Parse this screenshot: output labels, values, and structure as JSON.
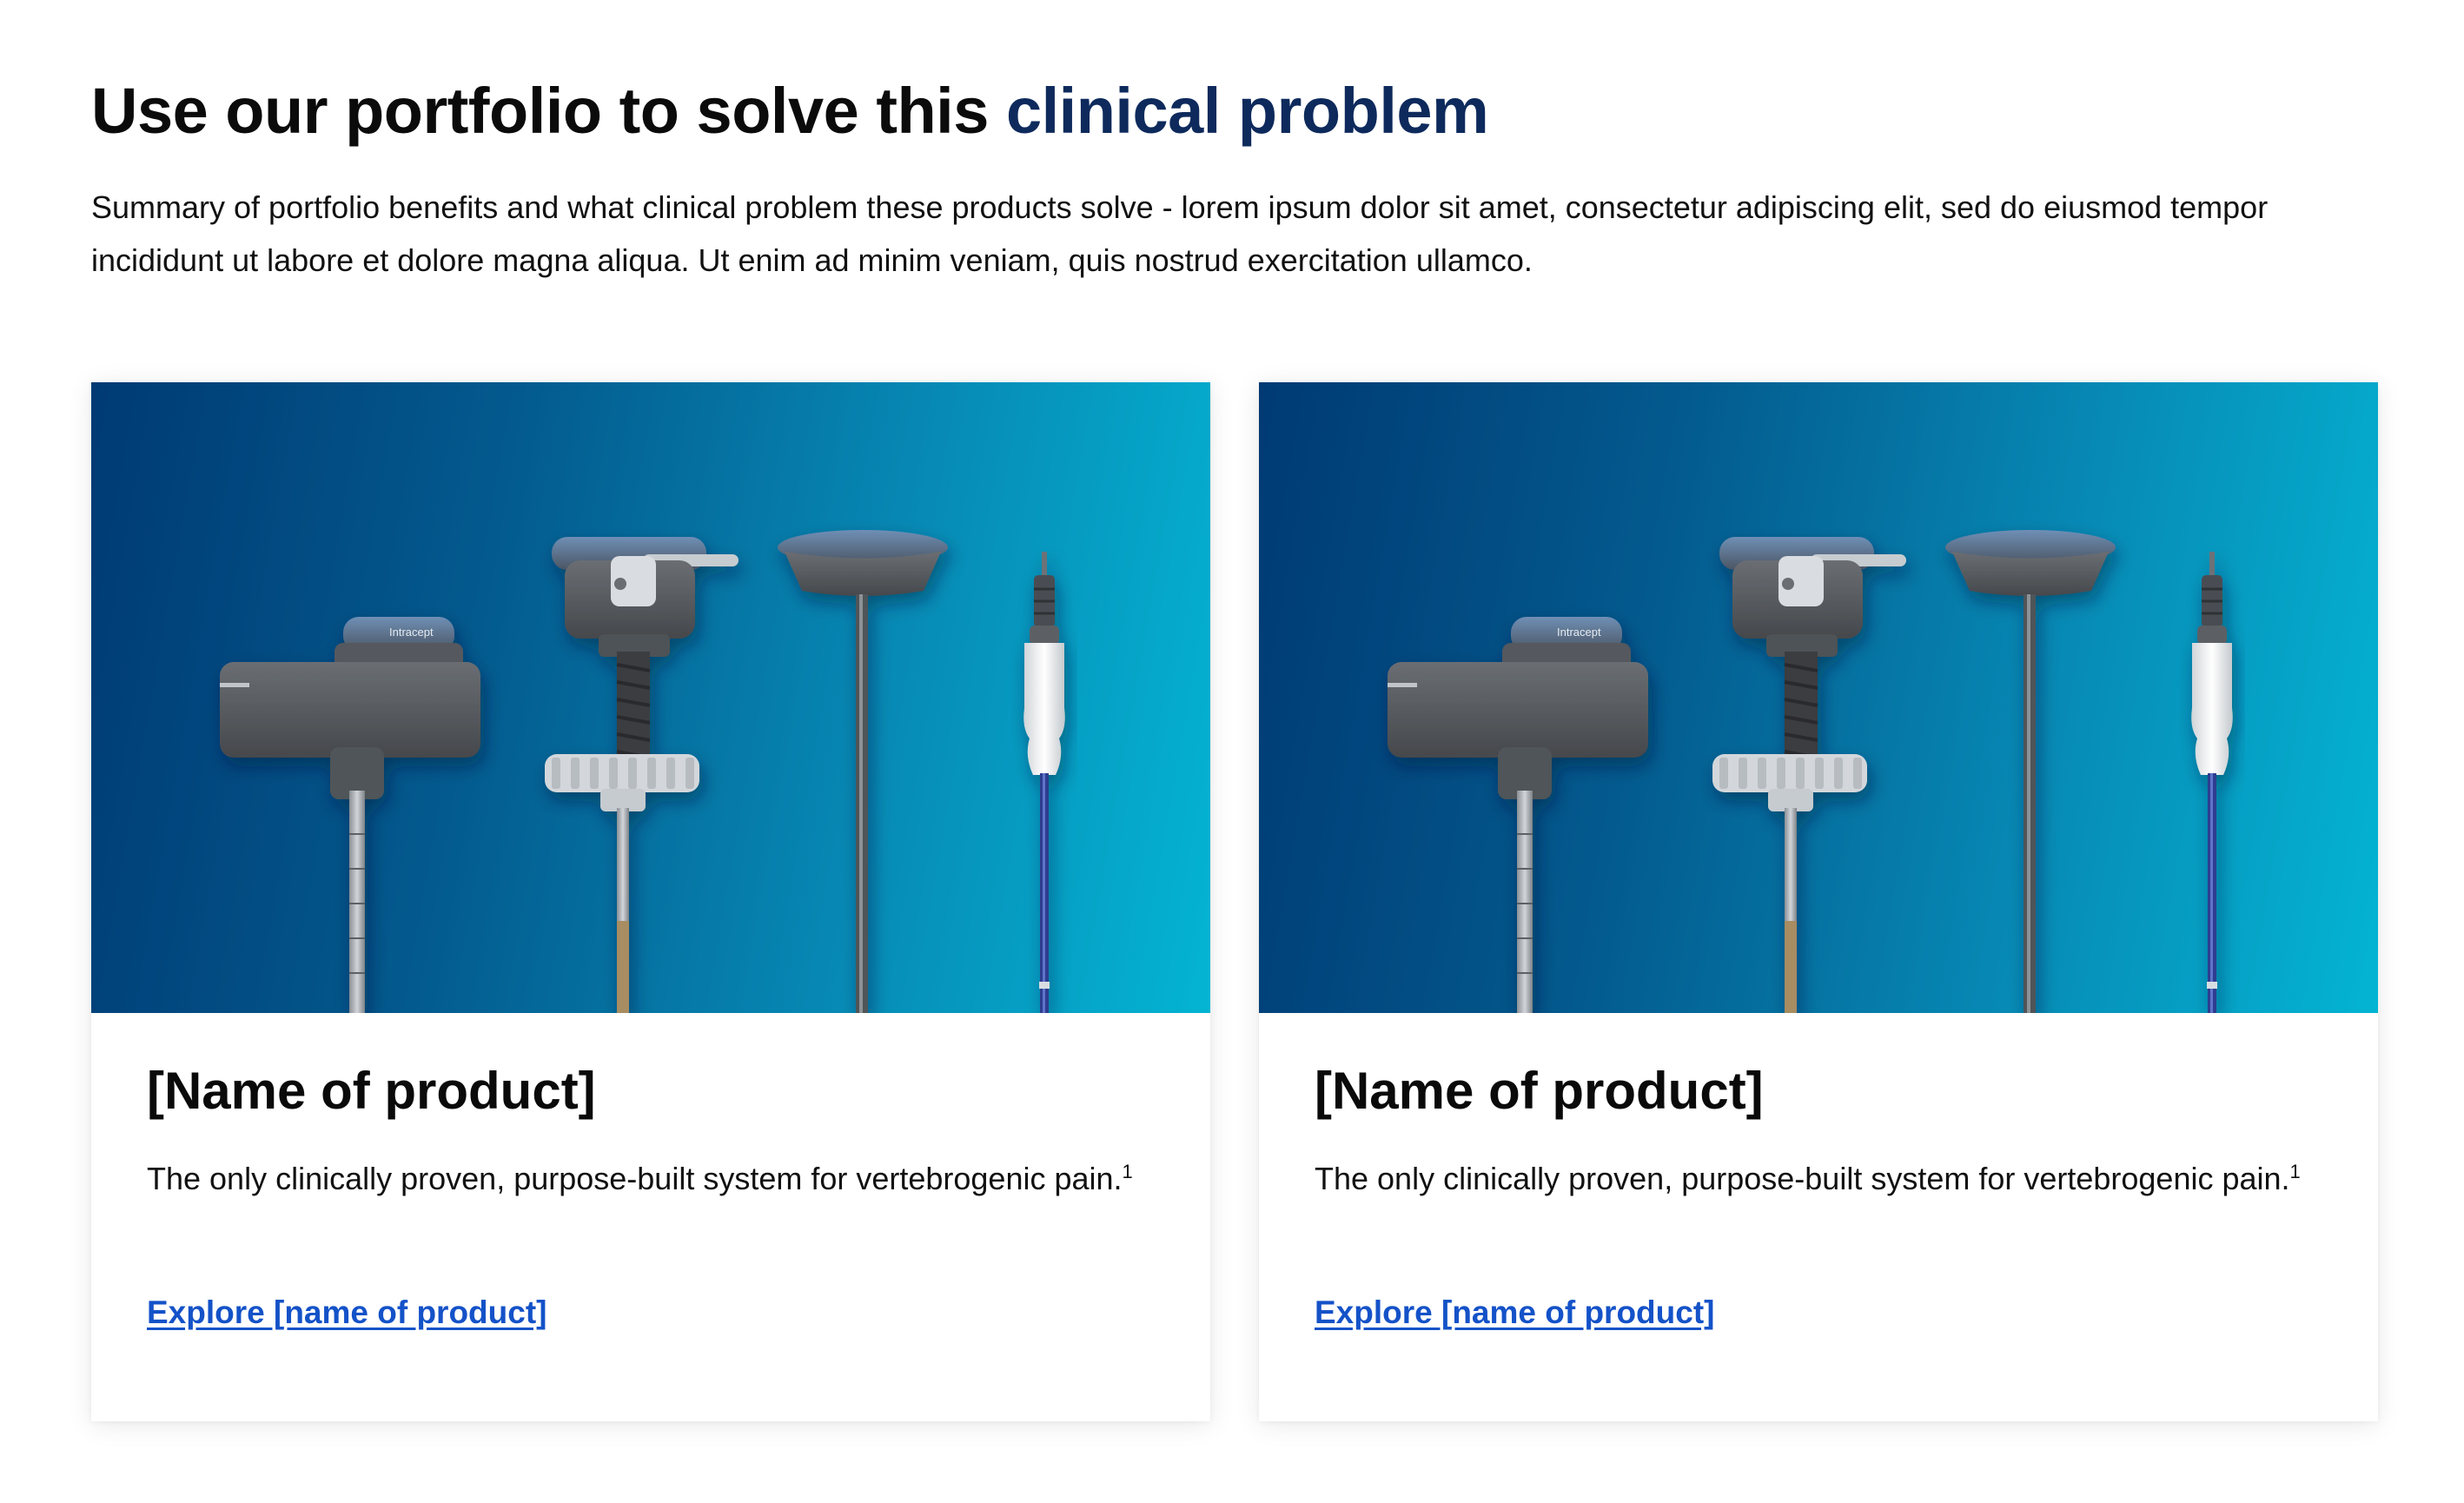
{
  "section": {
    "heading_part1": "Use our portfolio to solve this ",
    "heading_part2": "clinical problem",
    "summary": "Summary of portfolio benefits and what clinical problem these products solve - lorem ipsum dolor sit amet, consectetur adipiscing elit, sed do eiusmod tempor incididunt ut labore et dolore magna aliqua. Ut enim ad minim veniam, quis nostrud exercitation ullamco."
  },
  "cards": [
    {
      "image_brand_text": "Intracept",
      "title": "[Name of product]",
      "description": "The only clinically proven, purpose-built system for vertebrogenic pain.",
      "footnote": "1",
      "link_label": "Explore [name of product]"
    },
    {
      "image_brand_text": "Intracept",
      "title": "[Name of product]",
      "description": "The only clinically proven, purpose-built system for vertebrogenic pain.",
      "footnote": "1",
      "link_label": "Explore [name of product]"
    }
  ],
  "colors": {
    "heading_dark": "#0b0b0b",
    "heading_accent": "#0e2a5c",
    "link": "#1452c8",
    "image_gradient_start": "#003a74",
    "image_gradient_end": "#04b4d3"
  }
}
